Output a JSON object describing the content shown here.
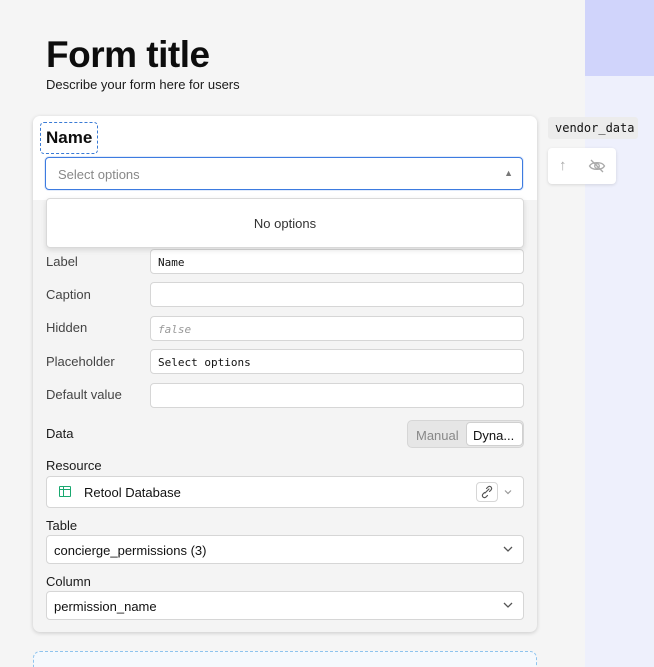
{
  "form": {
    "title": "Form title",
    "description": "Describe your form here for users"
  },
  "field": {
    "name_label": "Name",
    "select_placeholder": "Select options",
    "dropdown_empty": "No options"
  },
  "inspector": {
    "rows": [
      {
        "label": "Label",
        "value": "Name"
      },
      {
        "label": "Caption",
        "value": ""
      },
      {
        "label": "Hidden",
        "value": "false"
      },
      {
        "label": "Placeholder",
        "value": "Select options"
      },
      {
        "label": "Default value",
        "value": ""
      }
    ],
    "data_label": "Data",
    "data_modes": [
      "Manual",
      "Dyna..."
    ],
    "data_selected": "Dyna...",
    "resource_label": "Resource",
    "resource_value": "Retool Database",
    "table_label": "Table",
    "table_value": "concierge_permissions (3)",
    "column_label": "Column",
    "column_value": "permission_name"
  },
  "side": {
    "vendor_tag": "vendor_data"
  },
  "icons": [
    "chevron-up-icon",
    "chevron-down-icon",
    "table-icon",
    "link-icon",
    "arrow-up-icon",
    "eye-off-icon"
  ],
  "colors": {
    "accent": "#3d7be0",
    "resource_icon": "#1aa870",
    "side_top": "#d0d4fb",
    "side_bg": "#eef0fc"
  }
}
